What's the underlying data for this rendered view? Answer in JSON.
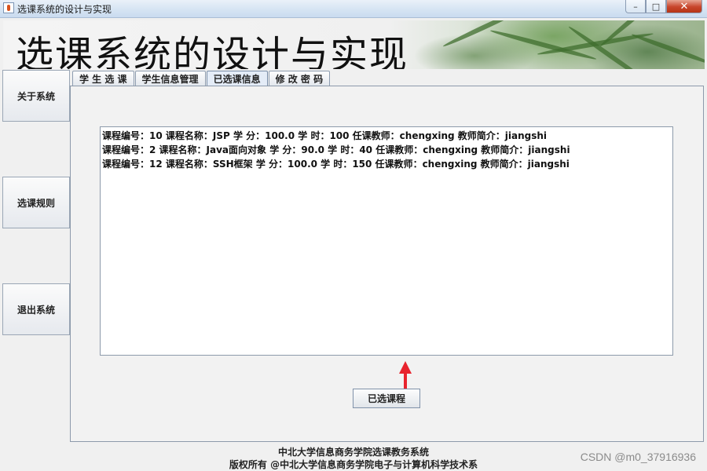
{
  "window": {
    "title": "选课系统的设计与实现",
    "controls": {
      "minimize": "–",
      "maximize": "□",
      "close": "✕"
    }
  },
  "banner": {
    "title": "选课系统的设计与实现"
  },
  "sidebar": {
    "items": [
      {
        "label": "关于系统"
      },
      {
        "label": "选课规则"
      },
      {
        "label": "退出系统"
      }
    ]
  },
  "tabs": [
    {
      "label": "学 生 选 课",
      "selected": false
    },
    {
      "label": "学生信息管理",
      "selected": false
    },
    {
      "label": "已选课信息",
      "selected": true
    },
    {
      "label": "修 改 密 码",
      "selected": false
    }
  ],
  "courses": [
    "课程编号：10  课程名称：JSP  学 分：100.0  学 时：100  任课教师：chengxing  教师简介：jiangshi",
    "课程编号：2  课程名称：Java面向对象  学 分：90.0  学 时：40  任课教师：chengxing  教师简介：jiangshi",
    "课程编号：12  课程名称：SSH框架  学 分：100.0  学 时：150  任课教师：chengxing  教师简介：jiangshi"
  ],
  "action_button": {
    "label": "已选课程"
  },
  "footer": {
    "line1": "中北大学信息商务学院选课教务系统",
    "line2": "版权所有 @中北大学信息商务学院电子与计算机科学技术系"
  },
  "watermark": "CSDN @m0_37916936",
  "colors": {
    "arrow": "#e8232d",
    "selected_tab": "#e4ecf7"
  },
  "icons": {
    "app": "java-cup-icon",
    "arrow": "up-arrow-icon"
  }
}
